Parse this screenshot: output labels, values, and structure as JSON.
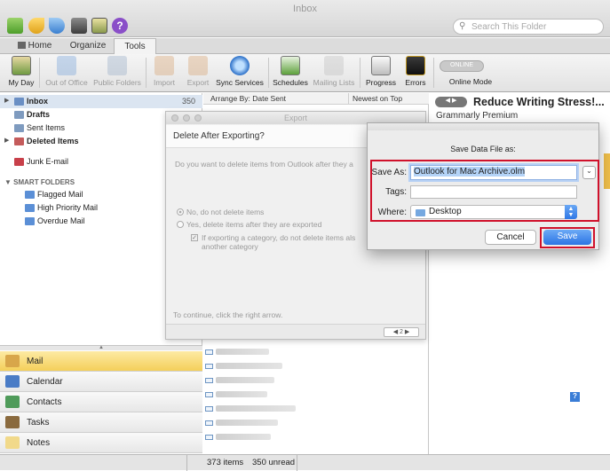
{
  "window": {
    "title": "Inbox"
  },
  "search": {
    "placeholder": "Search This Folder"
  },
  "tabs": [
    {
      "label": "Home"
    },
    {
      "label": "Organize"
    },
    {
      "label": "Tools"
    }
  ],
  "ribbon": {
    "my_day": "My Day",
    "out_of_office": "Out of Office",
    "public_folders": "Public Folders",
    "import": "Import",
    "export": "Export",
    "sync_services": "Sync Services",
    "schedules": "Schedules",
    "mailing_lists": "Mailing Lists",
    "progress": "Progress",
    "errors": "Errors",
    "online_badge": "ONLINE",
    "online_mode": "Online Mode"
  },
  "sidebar": {
    "inbox": "Inbox",
    "inbox_count": "350",
    "drafts": "Drafts",
    "sent": "Sent Items",
    "deleted": "Deleted Items",
    "junk": "Junk E-mail",
    "smart_header": "SMART FOLDERS",
    "smart": [
      "Flagged Mail",
      "High Priority Mail",
      "Overdue Mail"
    ]
  },
  "nav": [
    "Mail",
    "Calendar",
    "Contacts",
    "Tasks",
    "Notes"
  ],
  "list": {
    "arrange": "Arrange By: Date Sent",
    "sort": "Newest on Top"
  },
  "reading": {
    "subject": "Reduce Writing Stress!...",
    "sender": "Grammarly Premium"
  },
  "export_wizard": {
    "title": "Export",
    "heading": "Delete After Exporting?",
    "question": "Do you want to delete items from Outlook after they a",
    "opt_no": "No, do not delete items",
    "opt_yes": "Yes, delete items after they are exported",
    "sub_line1": "If exporting a category, do not delete items als",
    "sub_line2": "another category",
    "footer": "To continue, click the right arrow.",
    "page": "2"
  },
  "save_dialog": {
    "title": "Save Data File as:",
    "save_as_label": "Save As:",
    "save_as_value": "Outlook for Mac Archive.olm",
    "tags_label": "Tags:",
    "where_label": "Where:",
    "where_value": "Desktop",
    "cancel": "Cancel",
    "save": "Save"
  },
  "status": {
    "items": "373 items",
    "unread": "350 unread"
  }
}
